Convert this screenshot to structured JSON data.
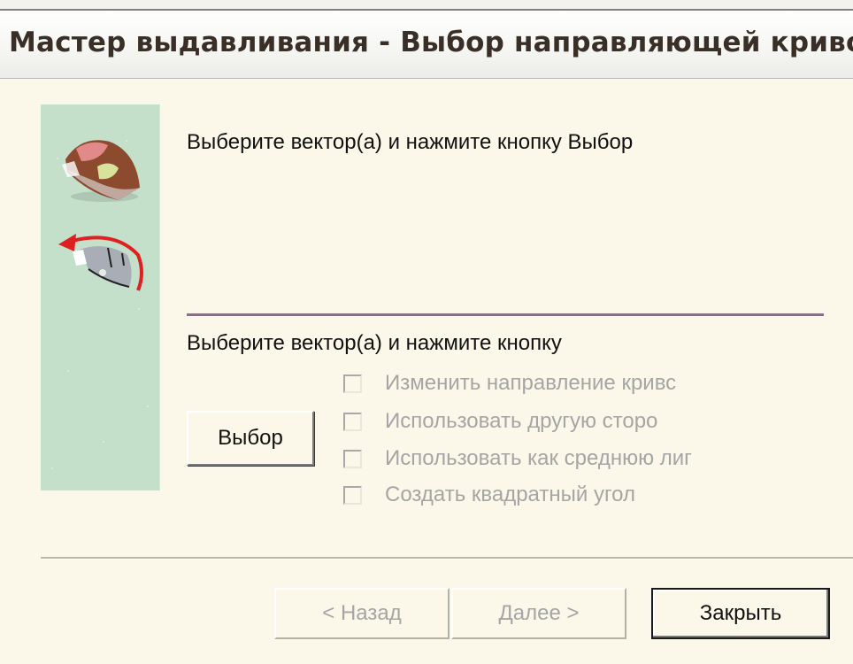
{
  "window": {
    "title": "Мастер выдавливания - Выбор направляющей кривой"
  },
  "content": {
    "instruction_top": "Выберите вектор(а) и нажмите кнопку Выбор",
    "instruction_bottom": "Выберите вектор(а) и нажмите кнопку",
    "select_button": "Выбор",
    "options": [
      {
        "label": "Изменить направление кривс",
        "checked": false,
        "enabled": false
      },
      {
        "label": "Использовать другую сторо",
        "checked": false,
        "enabled": false
      },
      {
        "label": "Использовать как среднюю лиг",
        "checked": false,
        "enabled": false
      },
      {
        "label": "Создать квадратный угол",
        "checked": false,
        "enabled": false
      }
    ]
  },
  "footer": {
    "back_button": "< Назад",
    "next_button": "Далее >",
    "close_button": "Закрыть"
  },
  "icons": {
    "top": "extrude-solid-icon",
    "bottom": "rotate-direction-icon"
  }
}
